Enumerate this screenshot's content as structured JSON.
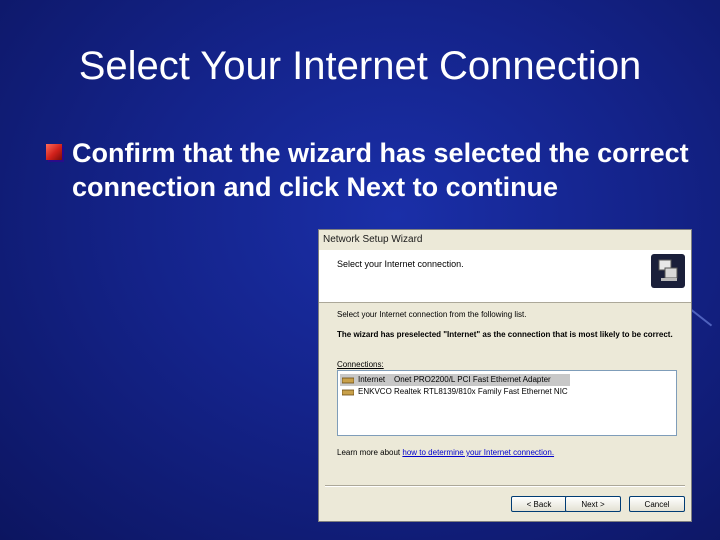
{
  "slide": {
    "title": "Select Your Internet Connection",
    "bullet": "Confirm that the wizard has selected the correct connection and click Next to continue"
  },
  "wizard": {
    "window_title": "Network Setup Wizard",
    "header_title": "Select your Internet connection.",
    "header_icon": "network-computers-icon",
    "instruction": "Select your Internet connection from the following list.",
    "note": "The wizard has preselected \"Internet\" as the connection that is most likely to be correct.",
    "connections_label": "Connections:",
    "connections": [
      {
        "name": "Internet",
        "device": "Onet PRO2200/L PCI Fast Ethernet Adapter",
        "selected": true
      },
      {
        "name": "ENKVCO",
        "device": "Realtek RTL8139/810x Family Fast Ethernet NIC",
        "selected": false
      }
    ],
    "learn_more_prefix": "Learn more about",
    "learn_more_link": "how to determine your Internet connection.",
    "buttons": {
      "back": "< Back",
      "next": "Next >",
      "cancel": "Cancel"
    }
  },
  "colors": {
    "background": "#14238a",
    "bullet": "#d0201a",
    "window": "#ece9d8"
  }
}
